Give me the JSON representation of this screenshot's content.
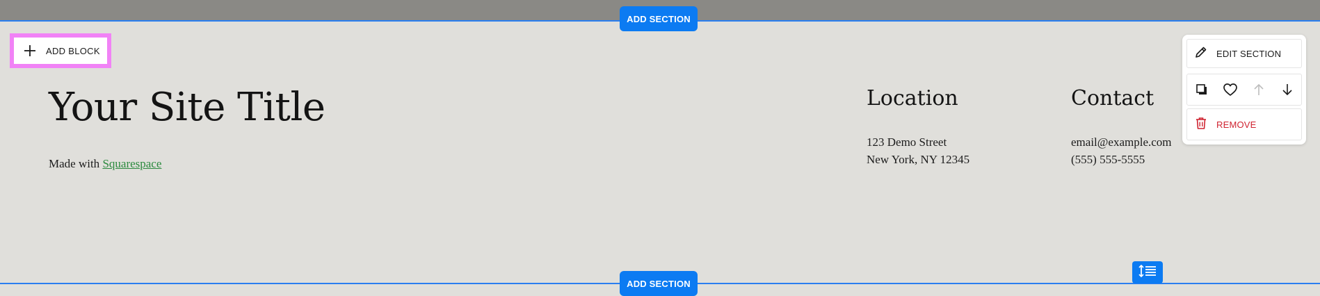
{
  "editor": {
    "add_section_top_label": "ADD SECTION",
    "add_section_bottom_label": "ADD SECTION",
    "add_block_label": "ADD BLOCK",
    "accent_color": "#0c7bf2",
    "highlight_color": "#f182f6"
  },
  "footer": {
    "site_title": "Your Site Title",
    "made_with_prefix": "Made with ",
    "made_with_link": "Squarespace",
    "location": {
      "heading": "Location",
      "lines": [
        "123 Demo Street",
        "New York, NY 12345"
      ]
    },
    "contact": {
      "heading": "Contact",
      "lines": [
        "email@example.com",
        "(555) 555-5555"
      ]
    }
  },
  "section_toolbar": {
    "edit_label": "EDIT SECTION",
    "remove_label": "REMOVE",
    "icons": [
      "duplicate-icon",
      "heart-icon",
      "arrow-up-icon",
      "arrow-down-icon"
    ],
    "remove_color": "#cf2330"
  }
}
